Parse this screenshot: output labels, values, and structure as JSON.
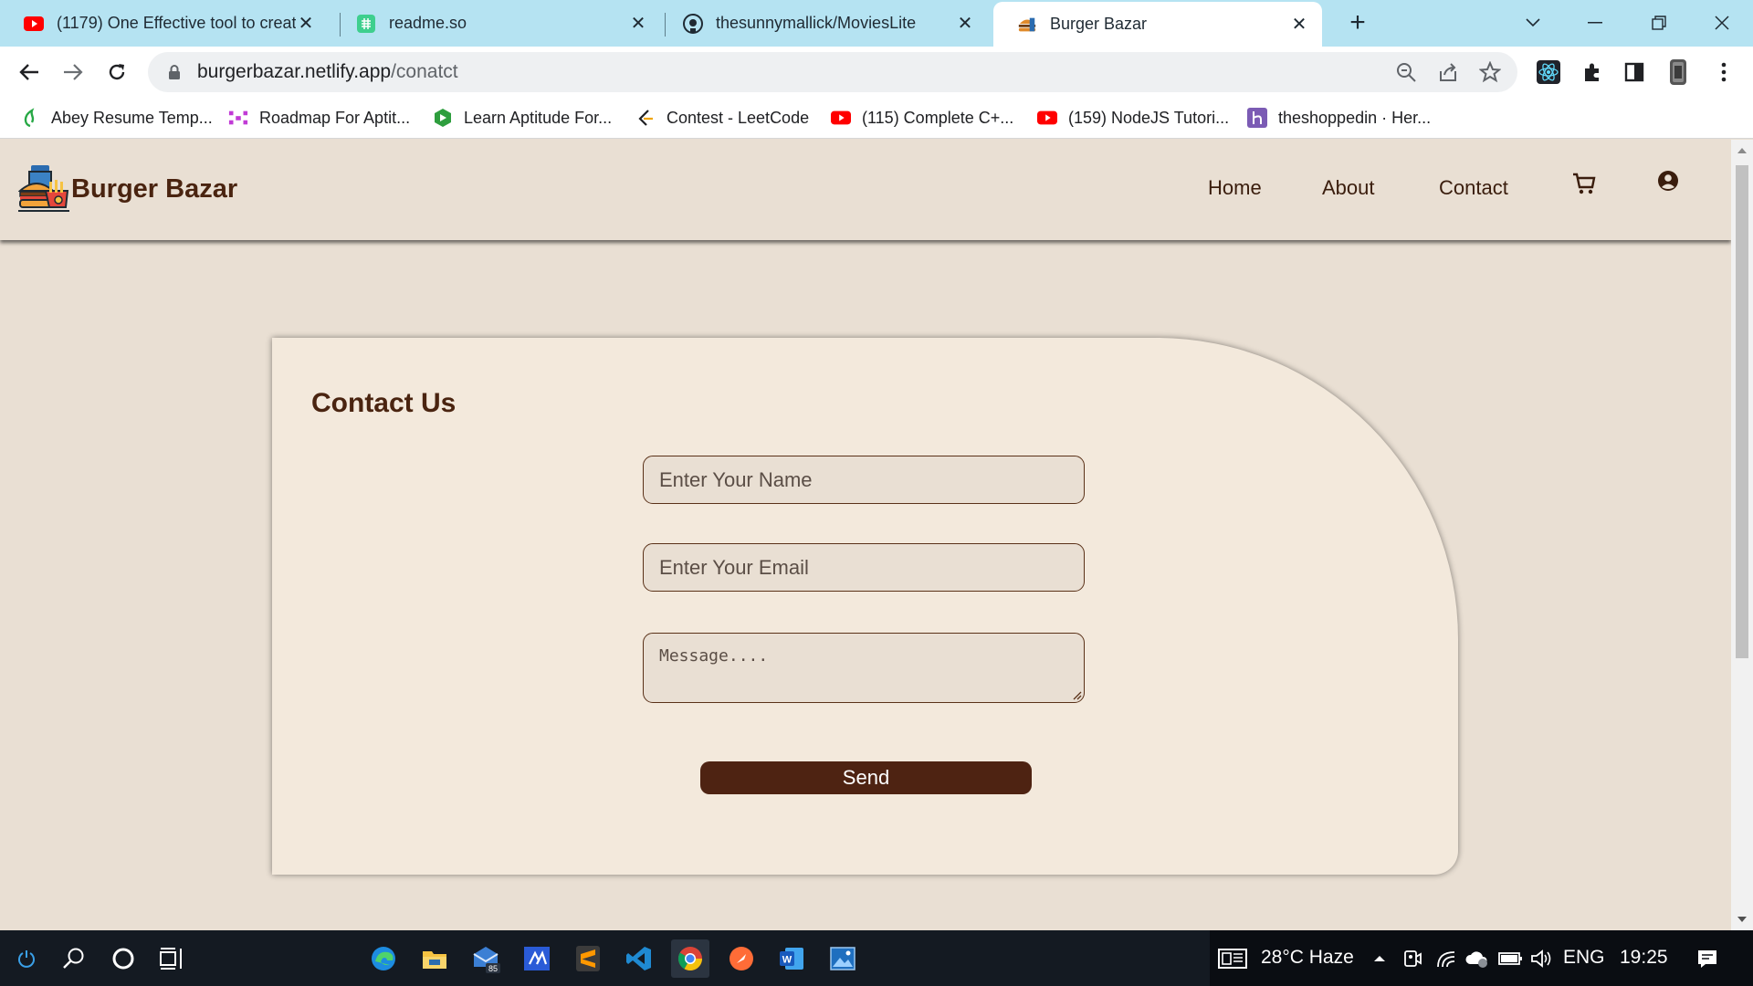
{
  "browser": {
    "tabs": [
      {
        "title": "(1179) One Effective tool to creat",
        "icon": "youtube-icon"
      },
      {
        "title": "readme.so",
        "icon": "readme-icon"
      },
      {
        "title": "thesunnymallick/MoviesLite",
        "icon": "github-icon"
      },
      {
        "title": "Burger Bazar",
        "icon": "burger-icon",
        "active": true
      }
    ],
    "url_host": "burgerbazar.netlify.app",
    "url_path": "/conatct",
    "bookmarks": [
      {
        "label": "Abey Resume Temp...",
        "icon": "leaf-icon"
      },
      {
        "label": "Roadmap For Aptit...",
        "icon": "roadmap-icon"
      },
      {
        "label": "Learn Aptitude For...",
        "icon": "hexagon-icon"
      },
      {
        "label": "Contest - LeetCode",
        "icon": "leetcode-icon"
      },
      {
        "label": "(115) Complete C+...",
        "icon": "youtube-icon"
      },
      {
        "label": "(159) NodeJS Tutori...",
        "icon": "youtube-icon"
      },
      {
        "label": "theshoppedin · Her...",
        "icon": "heroku-icon"
      }
    ]
  },
  "site": {
    "brand": "Burger Bazar",
    "nav": {
      "home": "Home",
      "about": "About",
      "contact": "Contact"
    },
    "contact": {
      "heading": "Contact Us",
      "name_placeholder": "Enter Your Name",
      "email_placeholder": "Enter Your Email",
      "message_placeholder": "Message....",
      "send_label": "Send"
    }
  },
  "taskbar": {
    "weather": "28°C  Haze",
    "language": "ENG",
    "time": "19:25",
    "mail_badge": "85"
  },
  "colors": {
    "page_bg": "#e9dfd3",
    "card_bg": "#f3e9dc",
    "brand_brown": "#4a2410",
    "button_brown": "#4e2312",
    "tab_strip": "#b5e3f2"
  }
}
